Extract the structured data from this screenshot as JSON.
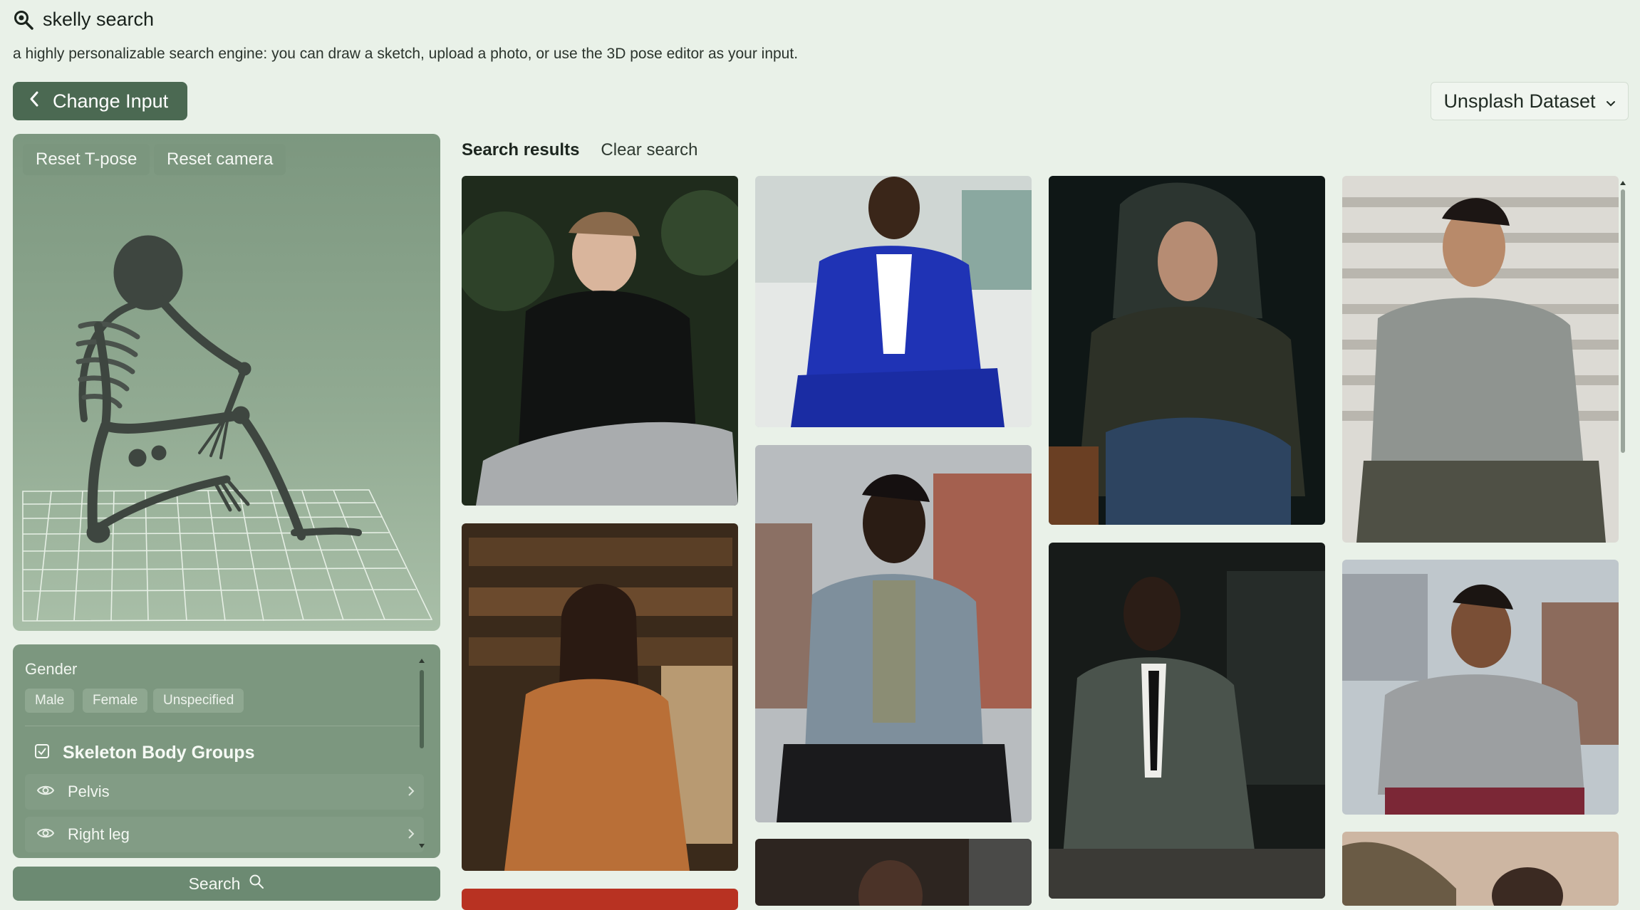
{
  "app": {
    "title": "skelly search",
    "description": "a highly personalizable search engine: you can draw a sketch, upload a photo, or use the 3D pose editor as your input."
  },
  "toolbar": {
    "change_input_label": "Change Input",
    "dataset_label": "Unsplash Dataset"
  },
  "pose_editor": {
    "reset_tpose_label": "Reset T-pose",
    "reset_camera_label": "Reset camera"
  },
  "options": {
    "gender_label": "Gender",
    "gender_options": [
      "Male",
      "Female",
      "Unspecified"
    ],
    "groups_title": "Skeleton Body Groups",
    "groups_checked": true,
    "groups": [
      {
        "label": "Pelvis",
        "visible": true
      },
      {
        "label": "Right leg",
        "visible": true
      }
    ]
  },
  "search_button_label": "Search",
  "results": {
    "tab_label": "Search results",
    "clear_label": "Clear search"
  },
  "colors": {
    "accent": "#4b6952",
    "panel": "#7c977f",
    "background": "#e9f1e8"
  },
  "icons": {
    "app": "search-magnifier-icon",
    "back": "chevron-left-icon",
    "dropdown": "chevron-down-icon",
    "checkbox": "checkbox-checked-icon",
    "eye": "eye-icon",
    "expand": "chevron-right-icon",
    "search": "search-icon"
  }
}
